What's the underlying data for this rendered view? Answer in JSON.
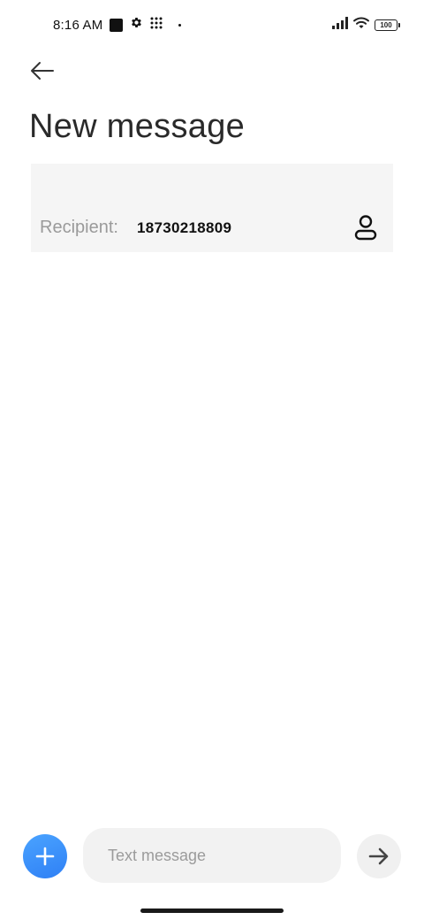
{
  "status_bar": {
    "time": "8:16 AM",
    "battery_level": "100",
    "icons": [
      "black-square-icon",
      "gear-icon",
      "grid-icon",
      "dot-icon",
      "signal-icon",
      "wifi-icon",
      "battery-icon"
    ]
  },
  "header": {
    "back_icon": "arrow-left-icon",
    "title": "New message"
  },
  "recipient": {
    "label": "Recipient:",
    "value": "18730218809",
    "contact_icon": "person-icon"
  },
  "composer": {
    "add_icon": "plus-icon",
    "placeholder": "Text message",
    "value": "",
    "send_icon": "arrow-right-icon"
  },
  "colors": {
    "accent": "#2f80f5",
    "recipient_bg": "#f5f5f5",
    "input_bg": "#f2f2f2"
  }
}
